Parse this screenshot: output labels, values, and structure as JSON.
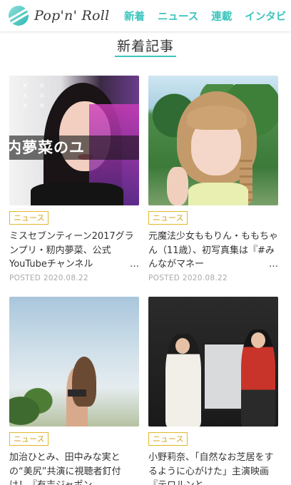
{
  "header": {
    "logo_text": "Pop'n' Roll",
    "nav": [
      "新着",
      "ニュース",
      "連載",
      "インタビ"
    ]
  },
  "section": {
    "title": "新着記事"
  },
  "articles": [
    {
      "category": "ニュース",
      "title": "ミスセブンティーン2017グランプリ・籾内夢菜、公式YouTubeチャンネル",
      "ellipsis": "…",
      "posted": "POSTED 2020.08.22",
      "thumb_text": "内夢菜のユ"
    },
    {
      "category": "ニュース",
      "title": "元魔法少女ももりん・ももちゃん（11歳）、初写真集は『#みんながマネー",
      "ellipsis": "…",
      "posted": "POSTED 2020.08.22"
    },
    {
      "category": "ニュース",
      "title": "加治ひとみ、田中みな実との“美尻”共演に視聴者釘付け！『有吉ジャポン",
      "ellipsis": "",
      "posted": ""
    },
    {
      "category": "ニュース",
      "title": "小野莉奈、「自然なお芝居をするように心がけた」主演映画『テロルンと",
      "ellipsis": "",
      "posted": ""
    }
  ]
}
